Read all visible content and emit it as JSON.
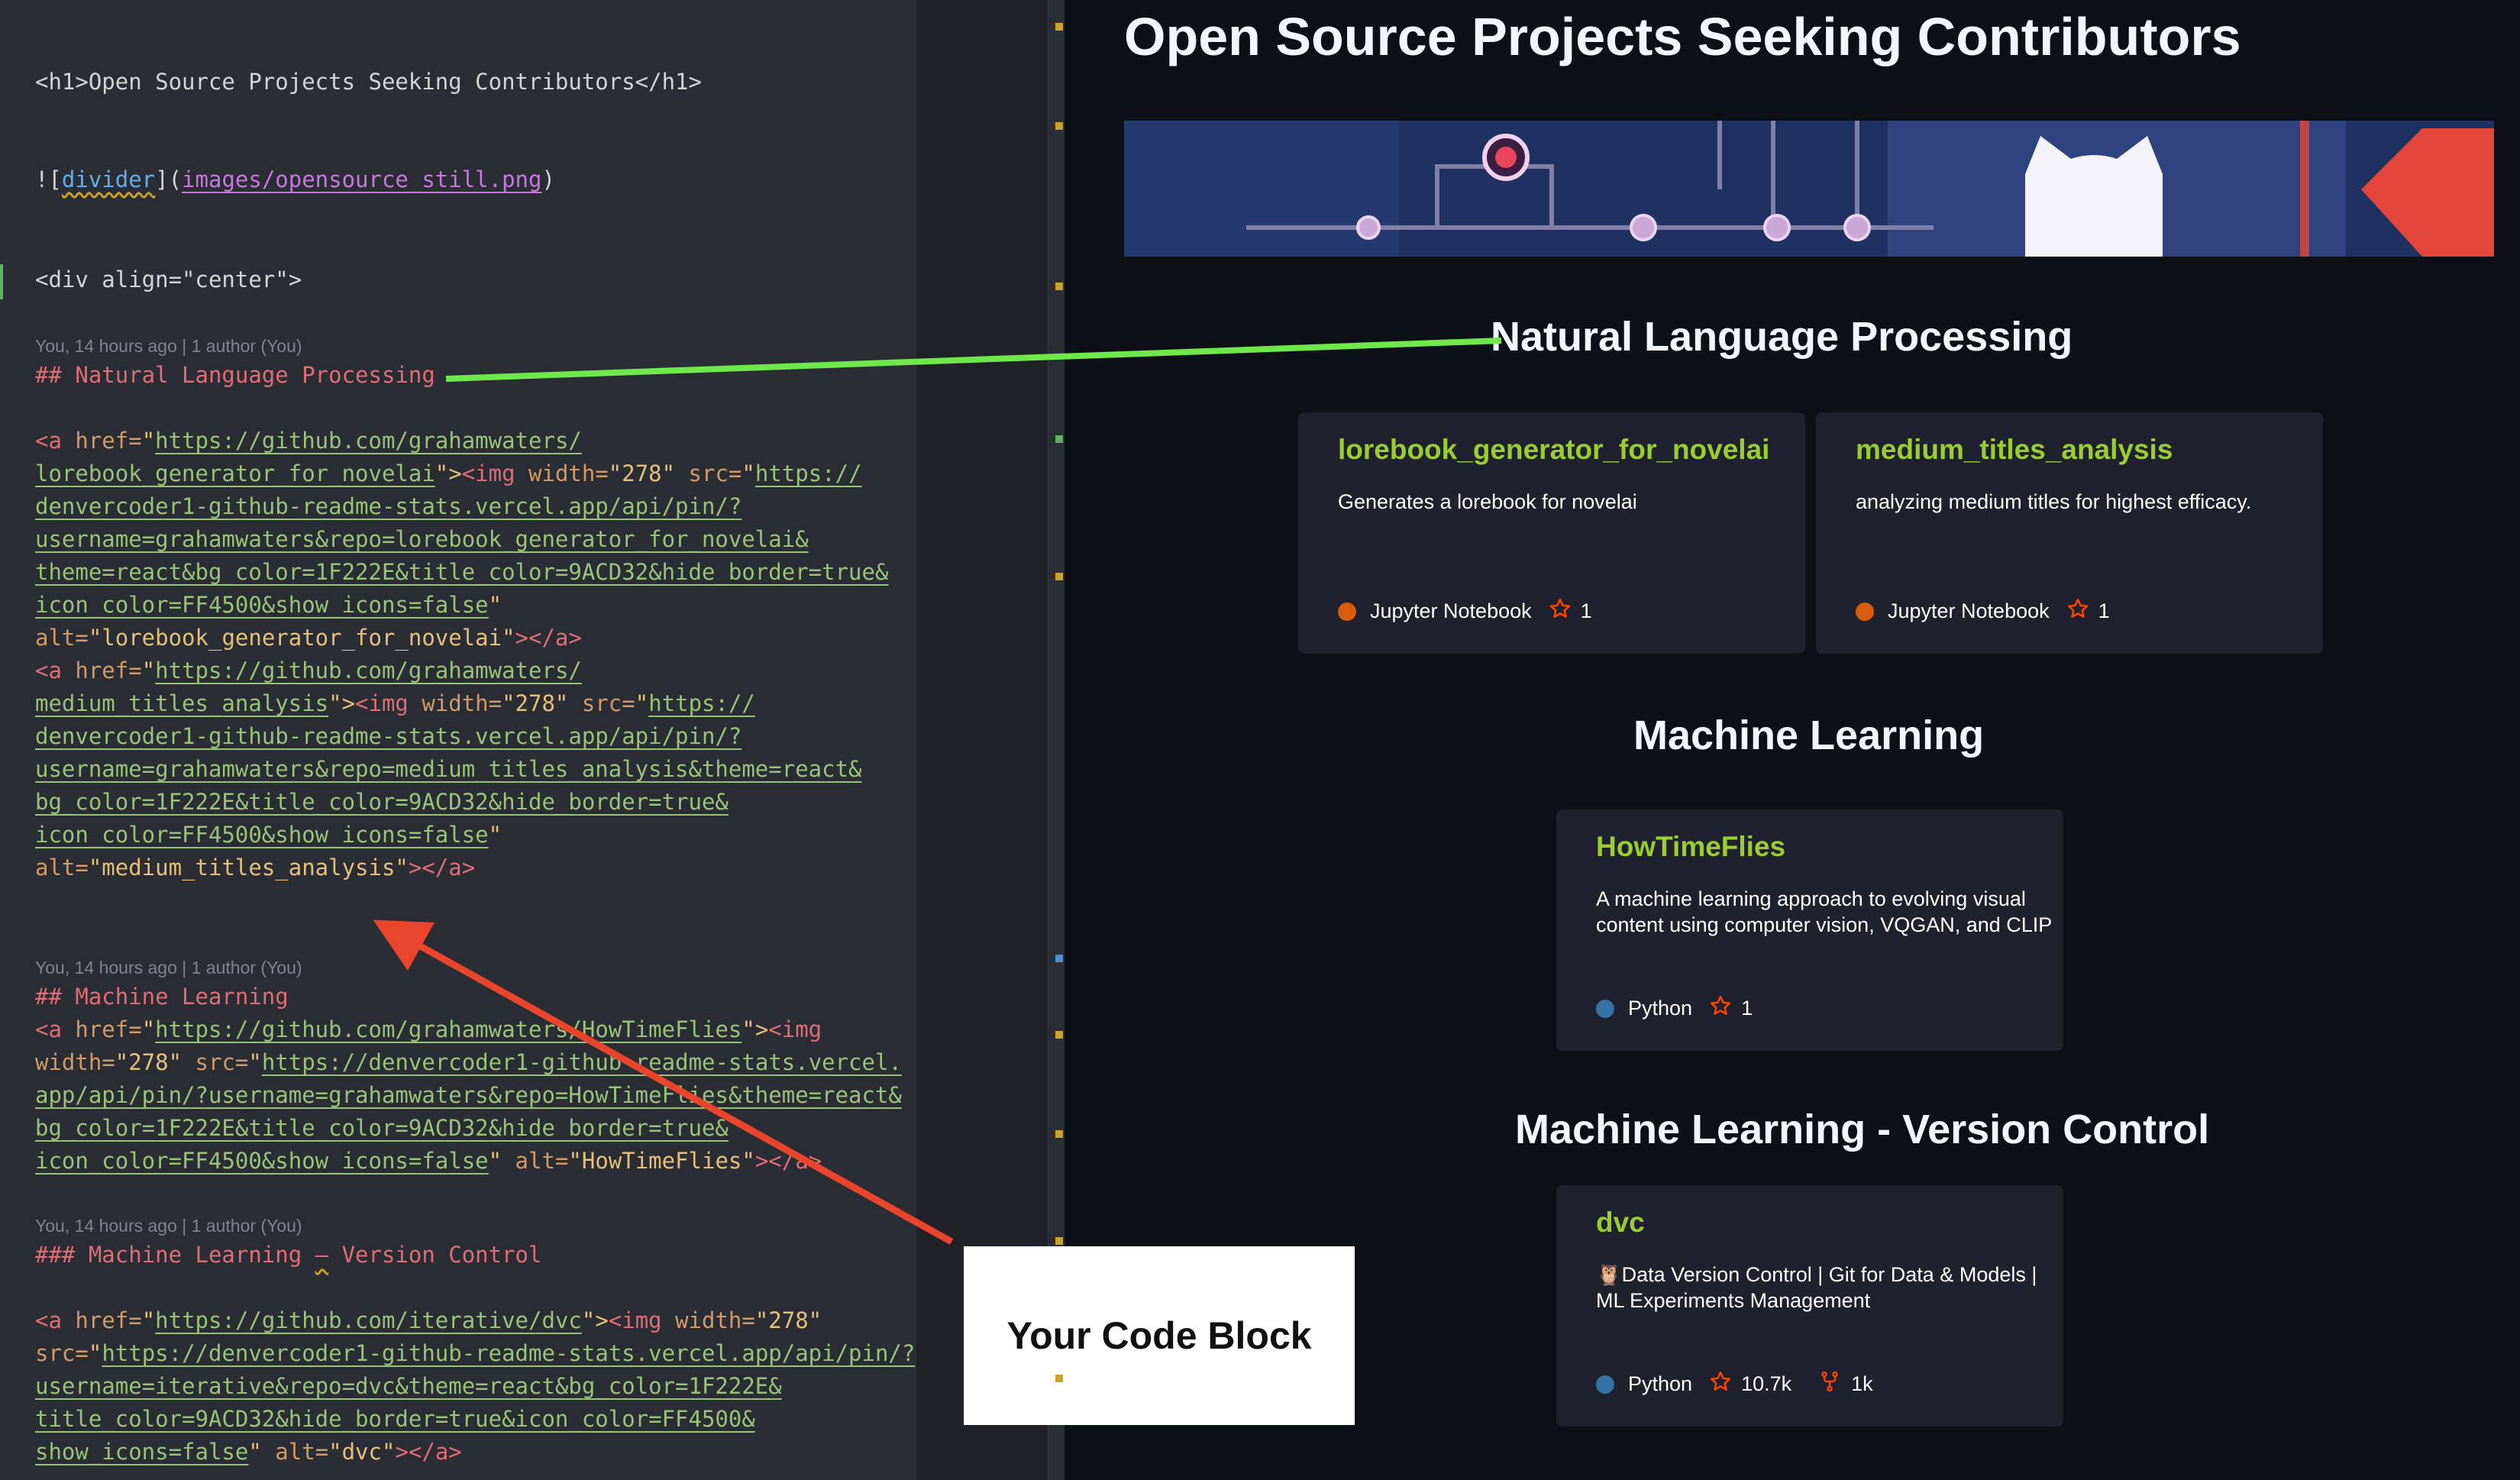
{
  "editor": {
    "line_h1": "<h1>Open Source Projects Seeking Contributors</h1>",
    "line_img_bang": "![",
    "line_img_alt": "divider",
    "line_img_mid": "](",
    "line_img_url": "images/opensource_still.png",
    "line_img_end": ")",
    "line_div": "<div align=\"center\">",
    "blame": "You, 14 hours ago | 1 author (You)",
    "nlp_heading": "## Natural Language Processing",
    "ml_heading": "## Machine Learning",
    "mlvc_heading_prefix": "### Machine Learning ",
    "mlvc_heading_dash": "–",
    "mlvc_heading_suffix": " Version Control",
    "code": {
      "a_open": "<a",
      "href_attr": " href=",
      "q": "\"",
      "close_gt": "\">",
      "img_open": "<img",
      "width_attr": " width=",
      "w278": "\"278\"",
      "src_attr": " src=",
      "alt_attr": "alt=",
      "a_close": "</a>",
      "close_img": "\"></a>",
      "nlp1_href1": "https://github.com/grahamwaters/",
      "nlp1_href2": "lorebook_generator_for_novelai",
      "nlp1_src1": "https://",
      "nlp1_src2": "denvercoder1-github-readme-stats.vercel.app/api/pin/?",
      "nlp1_src3": "username=grahamwaters&repo=lorebook_generator_for_novelai&",
      "nlp1_src4": "theme=react&bg_color=1F222E&title_color=9ACD32&hide_border=true&",
      "nlp1_src5": "icon_color=FF4500&show_icons=false",
      "nlp1_alt": "\"lorebook_generator_for_novelai\"",
      "nlp2_href1": "https://github.com/grahamwaters/",
      "nlp2_href2": "medium_titles_analysis",
      "nlp2_src1": "https://",
      "nlp2_src2": "denvercoder1-github-readme-stats.vercel.app/api/pin/?",
      "nlp2_src3": "username=grahamwaters&repo=medium_titles_analysis&theme=react&",
      "nlp2_src4": "bg_color=1F222E&title_color=9ACD32&hide_border=true&",
      "nlp2_src5": "icon_color=FF4500&show_icons=false",
      "nlp2_alt": "\"medium_titles_analysis\"",
      "ml_href": "https://github.com/grahamwaters/HowTimeFlies",
      "ml_src1": "https://denvercoder1-github-readme-stats.vercel.",
      "ml_src2": "app/api/pin/?username=grahamwaters&repo=HowTimeFlies&theme=react&",
      "ml_src3": "bg_color=1F222E&title_color=9ACD32&hide_border=true&",
      "ml_src4": "icon_color=FF4500&show_icons=false",
      "ml_alt": "\"HowTimeFlies\"",
      "dvc_href": "https://github.com/iterative/dvc",
      "dvc_src1": "https://denvercoder1-github-readme-stats.vercel.app/api/pin/?",
      "dvc_src2": "username=iterative&repo=dvc&theme=react&bg_color=1F222E&",
      "dvc_src3": "title_color=9ACD32&hide_border=true&icon_color=FF4500&",
      "dvc_src4": "show_icons=false",
      "dvc_alt": "\"dvc\""
    }
  },
  "preview": {
    "title": "Open Source Projects Seeking Contributors",
    "sections": {
      "nlp": "Natural Language Processing",
      "ml": "Machine Learning",
      "mlvc": "Machine Learning - Version Control"
    },
    "cards": [
      {
        "title": "lorebook_generator_for_novelai",
        "desc": "Generates a lorebook for novelai",
        "lang": "Jupyter Notebook",
        "lang_color": "#da5b0b",
        "stars": "1"
      },
      {
        "title": "medium_titles_analysis",
        "desc": "analyzing medium titles for highest efficacy.",
        "lang": "Jupyter Notebook",
        "lang_color": "#da5b0b",
        "stars": "1"
      },
      {
        "title": "HowTimeFlies",
        "desc": "A machine learning approach to evolving visual content using computer vision, VQGAN, and CLIP",
        "lang": "Python",
        "lang_color": "#3572a5",
        "stars": "1"
      },
      {
        "title": "dvc",
        "desc": "🦉Data Version Control | Git for Data & Models | ML Experiments Management",
        "lang": "Python",
        "lang_color": "#3572a5",
        "stars": "10.7k",
        "forks": "1k"
      }
    ],
    "colors": {
      "title": "#9ACD32",
      "icon": "#FF4500",
      "card_bg": "#1F222E"
    }
  },
  "overlay": {
    "callout_label": "Your Code Block",
    "green_arrow_color": "#6ee84a",
    "red_arrow_color": "#e8452c"
  }
}
